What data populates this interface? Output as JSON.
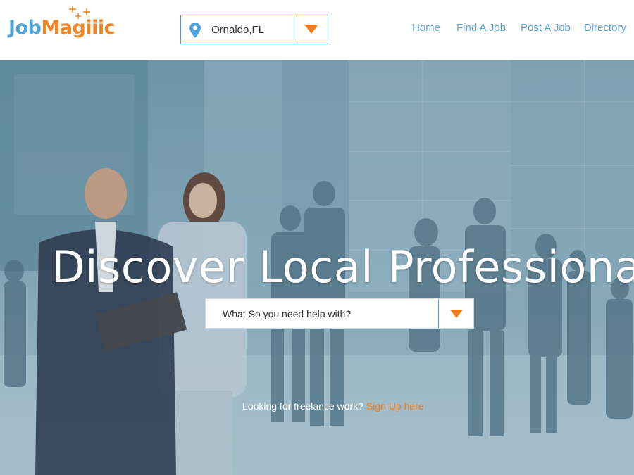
{
  "brand": {
    "logo_part1": "Job",
    "logo_part2": "Magiiic"
  },
  "location": {
    "value": "Ornaldo,FL",
    "icon": "map-pin-icon"
  },
  "nav": {
    "home": "Home",
    "find_job": "Find A Job",
    "post_job": "Post A Job",
    "directory": "Directory"
  },
  "hero": {
    "title": "Discover Local Professionals",
    "search_placeholder": "What So you need help with?",
    "freelance_text": "Looking for freelance work?",
    "signup_link": "Sign Up here"
  },
  "colors": {
    "accent_blue": "#4a9fcf",
    "accent_orange": "#ef7b1a"
  }
}
